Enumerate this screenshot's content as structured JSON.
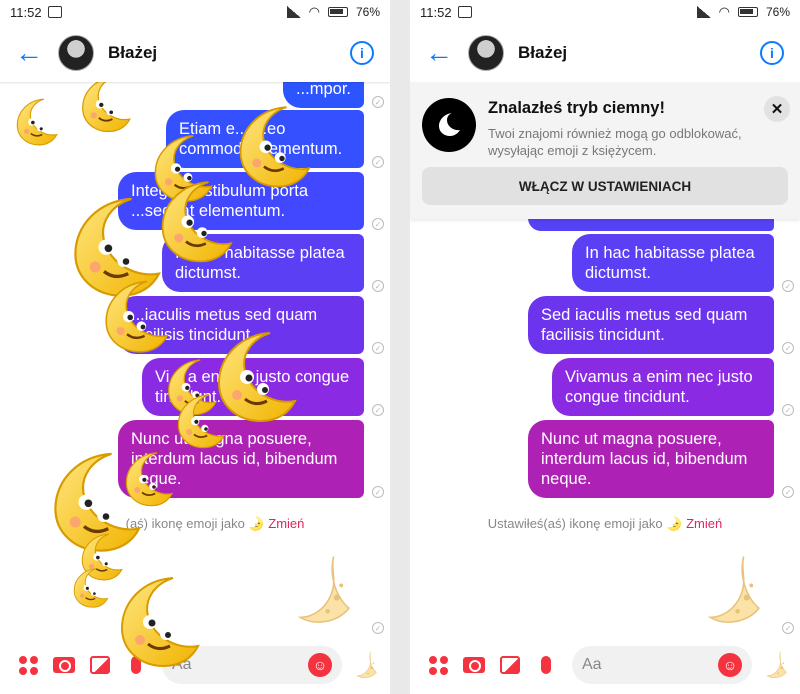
{
  "status": {
    "time": "11:52",
    "battery": "76%"
  },
  "header": {
    "contact_name": "Błażej"
  },
  "messages_left": [
    "...mpor.",
    "Etiam e... ...eo commodo elementum.",
    "Integer vestibulum porta ...sequat elementum.",
    "In hac habitasse platea dictumst.",
    "...iaculis metus sed quam facilisis tincidunt.",
    "Vi... a enim... justo congue tincidunt.",
    "Nunc ut magna posuere, interdum lacus id, bibendum neque."
  ],
  "messages_right": [
    "In hac habitasse platea dictumst.",
    "Sed iaculis metus sed quam facilisis tincidunt.",
    "Vivamus a enim nec justo congue tincidunt.",
    "Nunc ut magna posuere, interdum lacus id, bibendum neque."
  ],
  "system": {
    "emoji_set_left": "(aś) ikonę emoji jako 🌛",
    "emoji_set_right": "Ustawiłeś(aś) ikonę emoji jako 🌛",
    "change": "Zmień"
  },
  "banner": {
    "title": "Znalazłeś tryb ciemny!",
    "description": "Twoi znajomi również mogą go odblokować, wysyłając emoji z księżycem.",
    "enable_button": "WŁĄCZ W USTAWIENIACH"
  },
  "composer": {
    "placeholder": "Aa"
  },
  "icons": [
    "back-arrow-icon",
    "info-icon",
    "more-dots-icon",
    "camera-icon",
    "gallery-icon",
    "mic-icon",
    "smile-icon",
    "moon-icon",
    "close-icon",
    "check-icon"
  ],
  "colors": {
    "accent_blue": "#0a7cff",
    "accent_red": "#f5323f",
    "bubble_top": "#2d5bff",
    "bubble_bottom": "#c1209c"
  }
}
